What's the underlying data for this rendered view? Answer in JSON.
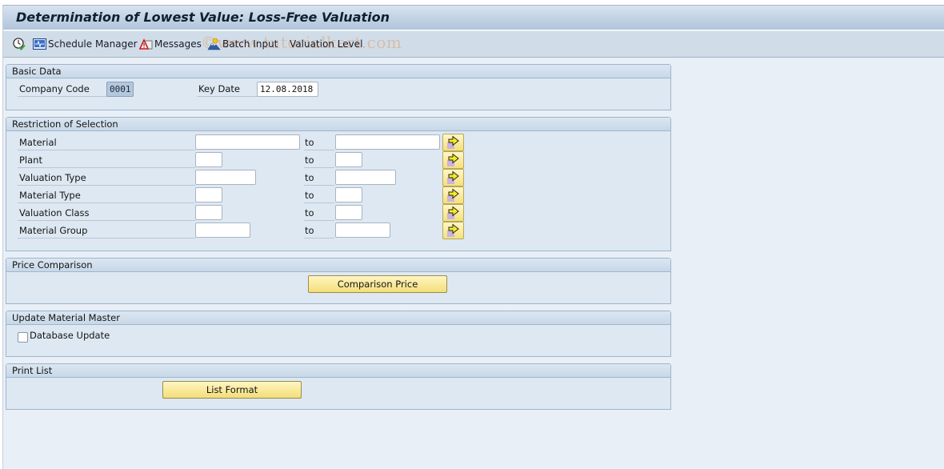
{
  "window": {
    "title": "Determination of Lowest Value: Loss-Free Valuation",
    "watermark": "©www.tutorialkart.com"
  },
  "toolbar": {
    "items": [
      {
        "id": "execute",
        "icon": "clock-check-icon",
        "label": ""
      },
      {
        "id": "schedule_manager",
        "icon": "schedule-monitor-icon",
        "label": "Schedule Manager"
      },
      {
        "id": "messages",
        "icon": "warning-messages-icon",
        "label": "Messages"
      },
      {
        "id": "batch_input",
        "icon": "batch-input-icon",
        "label": "Batch Input"
      },
      {
        "id": "valuation_level",
        "icon": "",
        "label": "Valuation Level"
      }
    ]
  },
  "basic_data": {
    "title": "Basic Data",
    "company_code": {
      "label": "Company Code",
      "value": "0001"
    },
    "key_date": {
      "label": "Key Date",
      "value": "12.08.2018"
    }
  },
  "restriction": {
    "title": "Restriction of Selection",
    "to_label": "to",
    "rows": [
      {
        "label": "Material",
        "from": "",
        "to": ""
      },
      {
        "label": "Plant",
        "from": "",
        "to": ""
      },
      {
        "label": "Valuation Type",
        "from": "",
        "to": ""
      },
      {
        "label": "Material Type",
        "from": "",
        "to": ""
      },
      {
        "label": "Valuation Class",
        "from": "",
        "to": ""
      },
      {
        "label": "Material Group",
        "from": "",
        "to": ""
      }
    ]
  },
  "price_comparison": {
    "title": "Price Comparison",
    "button_label": "Comparison Price"
  },
  "update_material_master": {
    "title": "Update Material Master",
    "database_update": {
      "label": "Database Update",
      "checked": false
    }
  },
  "print_list": {
    "title": "Print List",
    "button_label": "List Format"
  },
  "colors": {
    "background": "#e8eff7",
    "group_background": "#dde8f2",
    "button_yellow": "#f5e07a",
    "title_gradient_bottom": "#b0c5db"
  }
}
